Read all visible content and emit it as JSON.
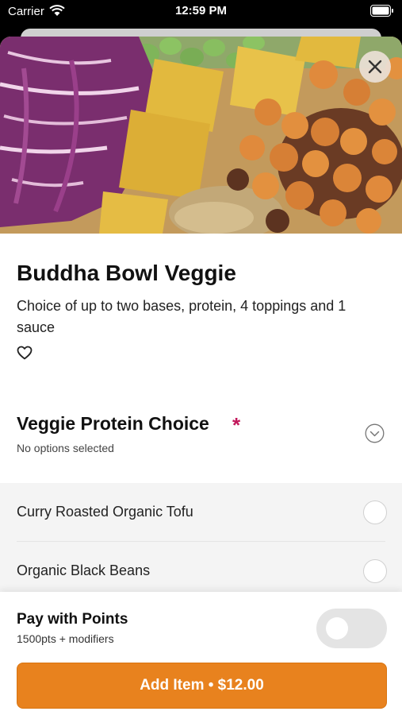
{
  "status_bar": {
    "carrier": "Carrier",
    "time": "12:59 PM"
  },
  "item": {
    "title": "Buddha Bowl Veggie",
    "description": "Choice of up to two bases, protein, 4 toppings and 1 sauce"
  },
  "modifier_group": {
    "title": "Veggie Protein Choice",
    "required_marker": "*",
    "status": "No options selected",
    "options": [
      {
        "label": "Curry Roasted Organic Tofu",
        "selected": false
      },
      {
        "label": "Organic Black Beans",
        "selected": false
      }
    ]
  },
  "footer": {
    "points_title": "Pay with Points",
    "points_sub": "1500pts + modifiers",
    "points_toggle_on": false,
    "add_button_label": "Add Item • $12.00"
  },
  "colors": {
    "accent": "#e8821e",
    "required": "#c2185b",
    "toggle_off": "#e4e4e4"
  },
  "icons": [
    "wifi-icon",
    "battery-icon",
    "close-icon",
    "heart-icon",
    "chevron-down-circle-icon"
  ]
}
